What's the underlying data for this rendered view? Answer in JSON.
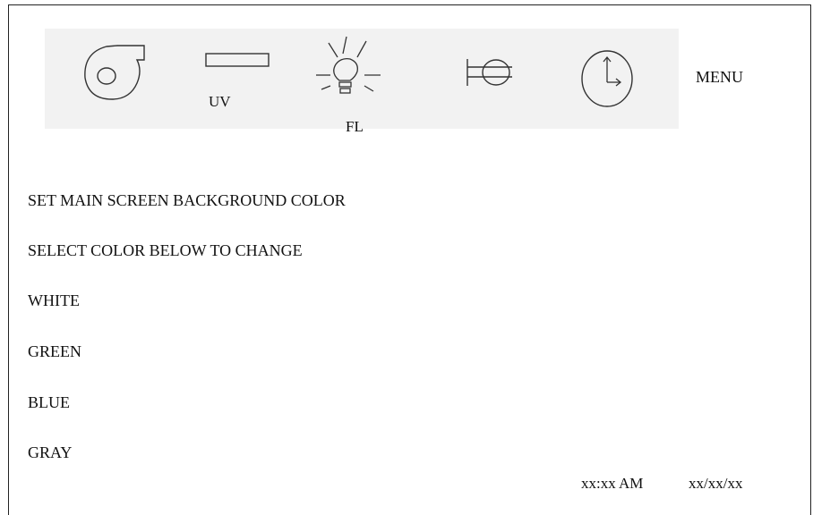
{
  "toolbar": {
    "uv_label": "UV",
    "fl_label": "FL",
    "menu_label": "MENU",
    "icons": [
      "blower-fan-icon",
      "uv-lamp-icon",
      "light-bulb-icon",
      "valve-icon",
      "clock-icon"
    ]
  },
  "screen": {
    "title": "SET MAIN SCREEN BACKGROUND COLOR",
    "instruction": "SELECT COLOR BELOW TO CHANGE",
    "options": [
      "WHITE",
      "GREEN",
      "BLUE",
      "GRAY"
    ]
  },
  "status": {
    "time": "xx:xx AM",
    "date": "xx/xx/xx"
  }
}
